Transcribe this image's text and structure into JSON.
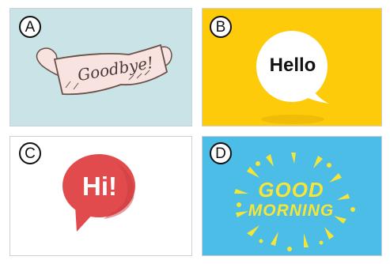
{
  "options": [
    {
      "letter": "A",
      "greeting": "Goodbye!",
      "bg": "#c9e3e6"
    },
    {
      "letter": "B",
      "greeting": "Hello",
      "bg": "#fdcb0a"
    },
    {
      "letter": "C",
      "greeting": "Hi!",
      "bg": "#ffffff"
    },
    {
      "letter": "D",
      "greeting_line1": "GOOD",
      "greeting_line2": "MORNING",
      "bg": "#4bbde6"
    }
  ],
  "colors": {
    "ribbon_fill": "#f8e3e0",
    "ribbon_stroke": "#6a5048",
    "hello_bubble": "#ffffff",
    "hi_bubble": "#e14b4d",
    "sun": "#f6e536"
  }
}
